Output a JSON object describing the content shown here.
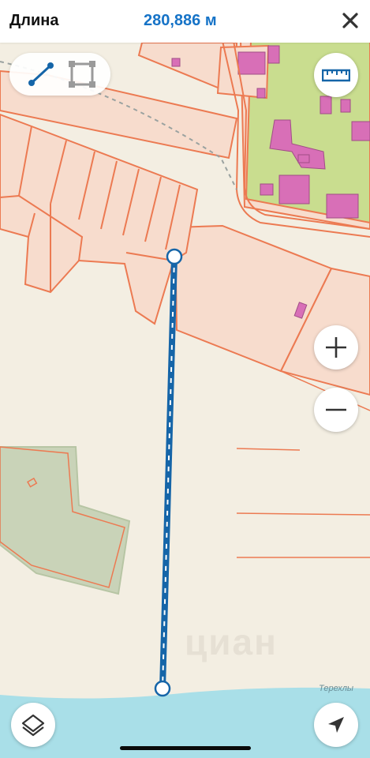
{
  "header": {
    "title": "Длина",
    "measurement": "280,886 м"
  },
  "map": {
    "place_label": "Терехлы",
    "watermark": "циан",
    "colors": {
      "background": "#f3eee2",
      "parcel_fill": "#f7dccd",
      "parcel_border": "#ec7a52",
      "green_zone": "#c9dd8f",
      "building": "#d86fb7",
      "forest": "#c9d3b8",
      "water": "#a9dfe8",
      "measure_line": "#1565a8"
    }
  },
  "controls": {
    "mode_buttons": [
      "line-mode",
      "area-mode"
    ],
    "zoom_in": "+",
    "zoom_out": "−"
  }
}
